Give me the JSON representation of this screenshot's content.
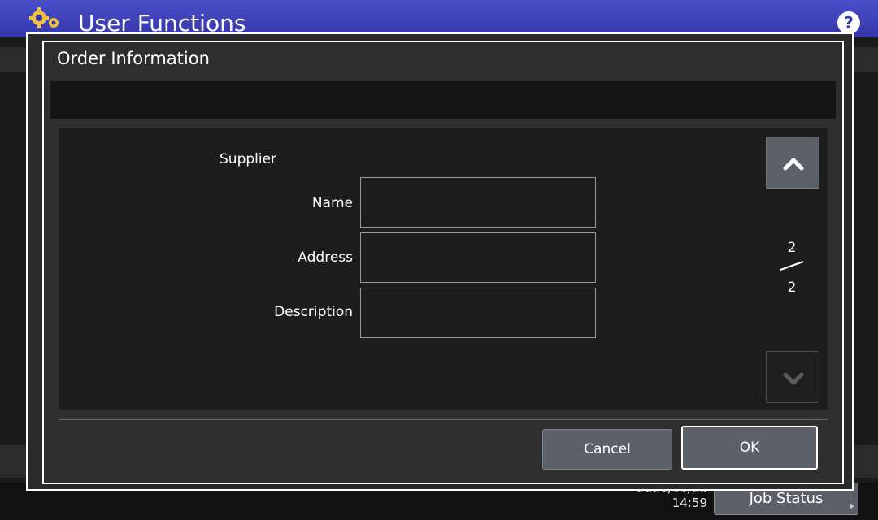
{
  "app": {
    "title": "User Functions",
    "help_label": "?"
  },
  "dialog": {
    "title": "Order Information",
    "section_label": "Supplier",
    "fields": [
      {
        "label": "Name",
        "value": ""
      },
      {
        "label": "Address",
        "value": ""
      },
      {
        "label": "Description",
        "value": ""
      }
    ],
    "pager": {
      "current": "2",
      "total": "2"
    },
    "buttons": {
      "cancel_label": "Cancel",
      "ok_label": "OK"
    }
  },
  "status_bar": {
    "date": "2021/11/26",
    "time": "14:59",
    "job_status_label": "Job Status"
  },
  "colors": {
    "header": "#3b3fb8",
    "background": "#1a1a1a",
    "button": "#5c6068",
    "accent": "#ffffff"
  },
  "icons": [
    "gear-icon",
    "help-icon",
    "chevron-up-icon",
    "chevron-down-icon",
    "play-arrow-icon"
  ]
}
